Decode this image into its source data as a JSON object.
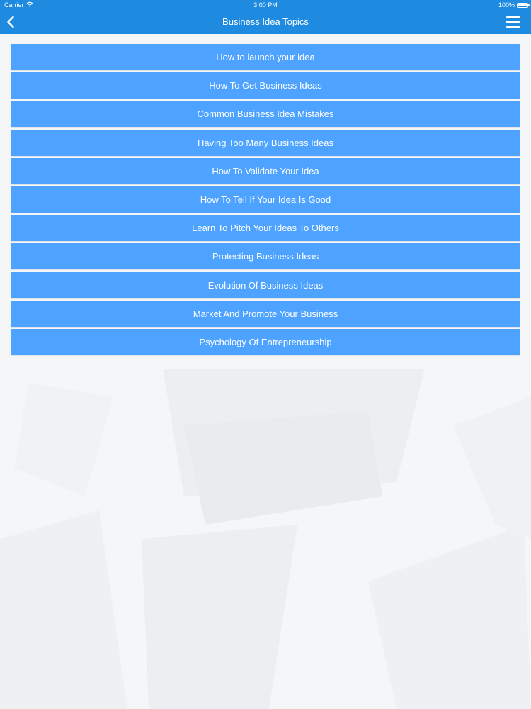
{
  "status_bar": {
    "carrier": "Carrier",
    "time": "3:00 PM",
    "battery": "100%",
    "wifi_icon": "wifi-icon",
    "battery_icon": "battery-icon"
  },
  "nav": {
    "title": "Business Idea Topics",
    "back_icon": "chevron-left-icon",
    "menu_icon": "hamburger-menu-icon"
  },
  "topics": [
    "How to launch your idea",
    "How To Get Business Ideas",
    "Common Business Idea Mistakes",
    "Having Too Many Business Ideas",
    "How To Validate Your Idea",
    "How To Tell If Your Idea Is Good",
    "Learn To Pitch Your Ideas To Others",
    "Protecting Business Ideas",
    "Evolution Of Business Ideas",
    "Market And Promote Your Business",
    "Psychology Of Entrepreneurship"
  ],
  "colors": {
    "nav_bar": "#1e8ae0",
    "topic_button": "#4da3ff",
    "text": "#ffffff",
    "background": "#f4f5f7"
  }
}
